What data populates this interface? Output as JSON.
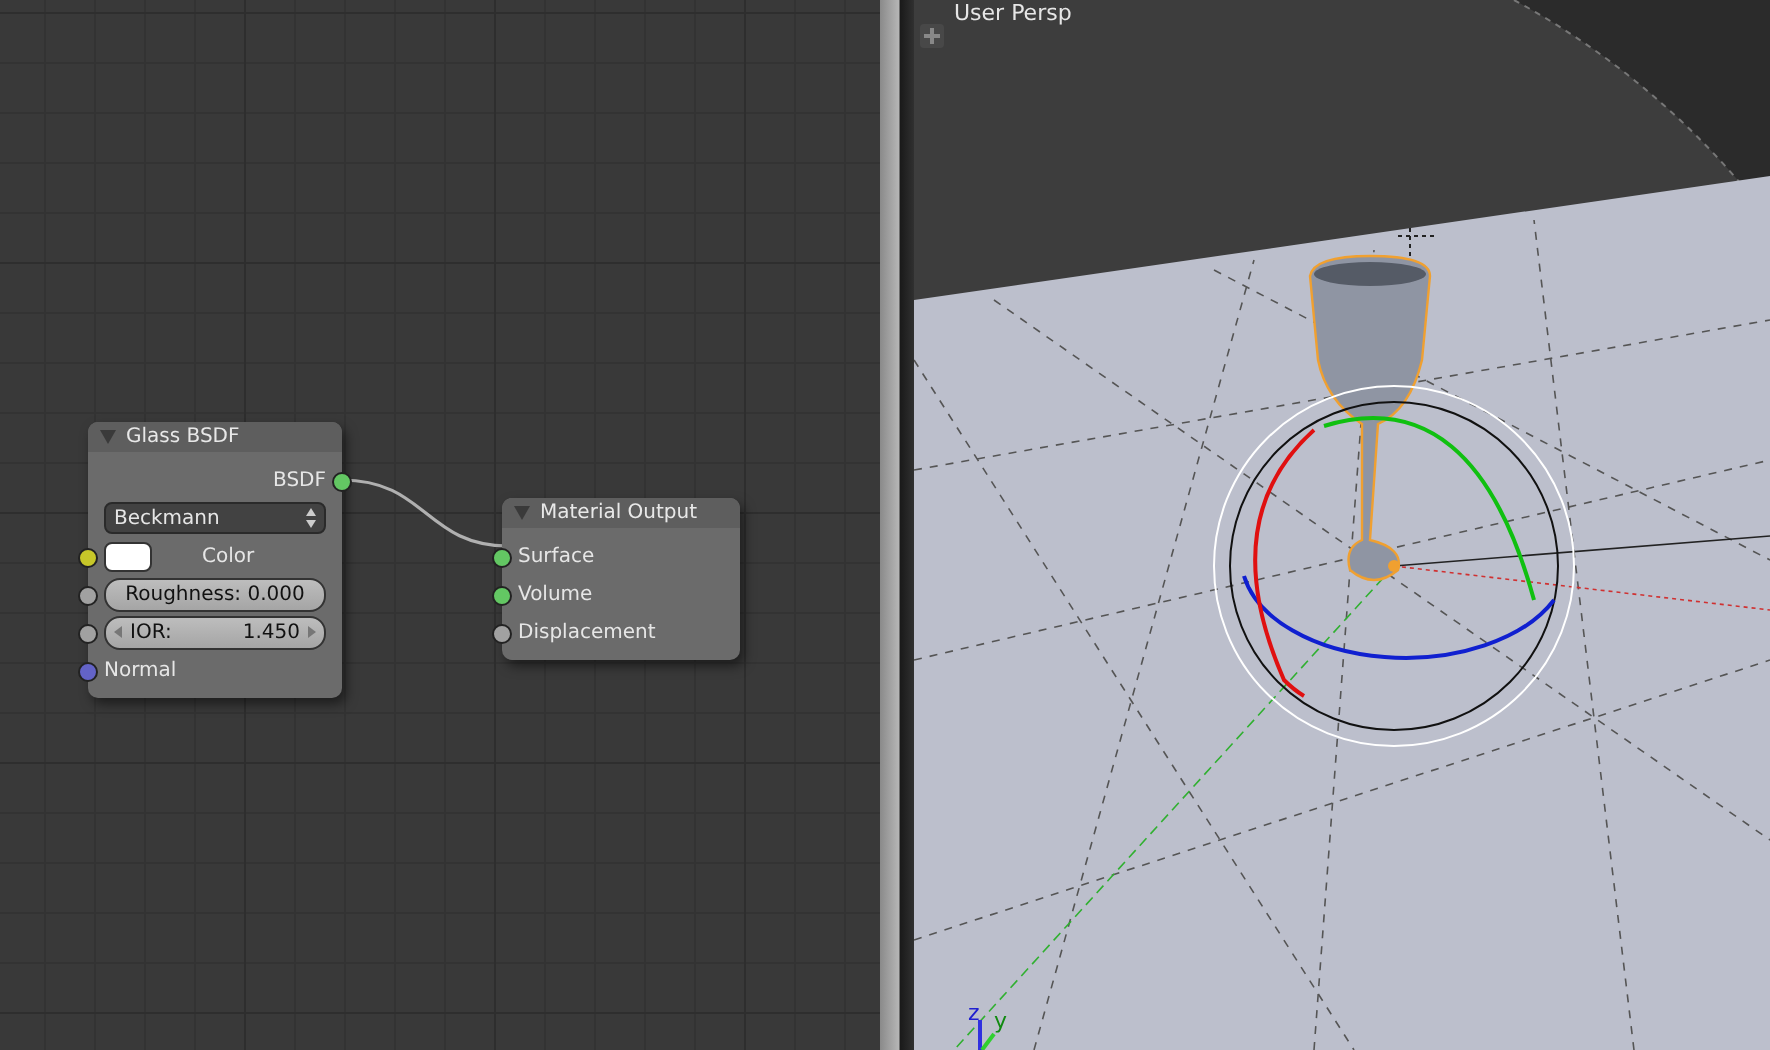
{
  "node_editor": {
    "nodes": [
      {
        "title": "Glass BSDF",
        "expanded": true,
        "rows": [
          {
            "kind": "output",
            "label": "BSDF",
            "socket": {
              "color": "#63c763"
            }
          },
          {
            "kind": "dropdown",
            "value": "Beckmann"
          },
          {
            "kind": "color",
            "label": "Color",
            "color": "#ffffff",
            "socket": {
              "color": "#c7c729"
            }
          },
          {
            "kind": "slider",
            "label": "Roughness: 0.000",
            "level": 0,
            "socket": {
              "color": "#a1a1a1"
            }
          },
          {
            "kind": "number",
            "label": "IOR:",
            "value": "1.450",
            "socket": {
              "color": "#a1a1a1"
            }
          },
          {
            "kind": "input",
            "label": "Normal",
            "socket": {
              "color": "#6363c7"
            }
          }
        ]
      },
      {
        "title": "Material Output",
        "expanded": true,
        "rows": [
          {
            "kind": "input",
            "label": "Surface",
            "socket": {
              "color": "#63c763"
            }
          },
          {
            "kind": "input",
            "label": "Volume",
            "socket": {
              "color": "#63c763"
            }
          },
          {
            "kind": "input",
            "label": "Displacement",
            "socket": {
              "color": "#a1a1a1"
            }
          }
        ]
      }
    ]
  },
  "viewport": {
    "title": "User Persp",
    "axis_labels": [
      {
        "label": "z",
        "color": "#2020d0"
      },
      {
        "label": "y",
        "color": "#108a10"
      }
    ]
  }
}
